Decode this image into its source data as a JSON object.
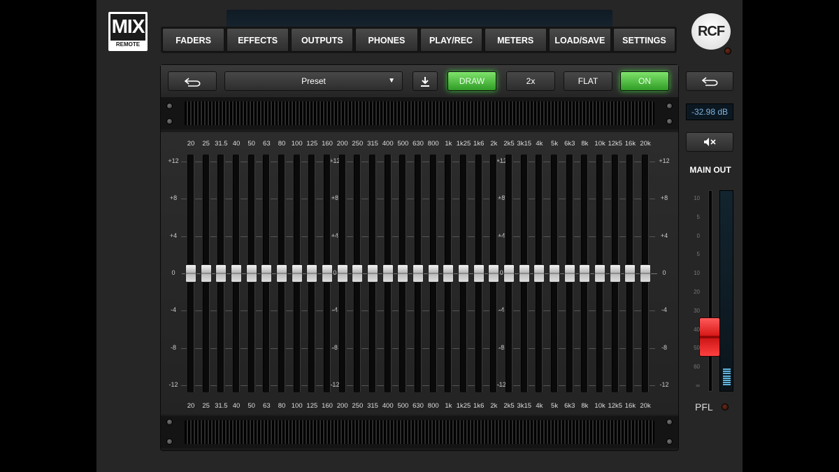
{
  "logo": {
    "main": "MIX",
    "sub": "REMOTE"
  },
  "brand": "RCF",
  "nav": [
    "FADERS",
    "EFFECTS",
    "OUTPUTS",
    "PHONES",
    "PLAY/REC",
    "METERS",
    "LOAD/SAVE",
    "SETTINGS"
  ],
  "toolbar": {
    "back_icon": "undo-arrow-icon",
    "preset_label": "Preset",
    "download_icon": "download-icon",
    "draw_label": "DRAW",
    "x2_label": "2x",
    "flat_label": "FLAT",
    "on_label": "ON",
    "accent_green": "#3fc43a"
  },
  "eq": {
    "bands": [
      "20",
      "25",
      "31.5",
      "40",
      "50",
      "63",
      "80",
      "100",
      "125",
      "160",
      "200",
      "250",
      "315",
      "400",
      "500",
      "630",
      "800",
      "1k",
      "1k25",
      "1k6",
      "2k",
      "2k5",
      "3k15",
      "4k",
      "5k",
      "6k3",
      "8k",
      "10k",
      "12k5",
      "16k",
      "20k"
    ],
    "scale_labels": [
      "+12",
      "+8",
      "+4",
      "0",
      "-4",
      "-8",
      "-12"
    ],
    "scale_values": [
      12,
      8,
      4,
      0,
      -4,
      -8,
      -12
    ],
    "gain_db": [
      0,
      0,
      0,
      0,
      0,
      0,
      0,
      0,
      0,
      0,
      0,
      0,
      0,
      0,
      0,
      0,
      0,
      0,
      0,
      0,
      0,
      0,
      0,
      0,
      0,
      0,
      0,
      0,
      0,
      0,
      0
    ]
  },
  "right": {
    "back_icon": "undo-arrow-icon",
    "readout": "-32.98 dB",
    "mute_icon": "speaker-mute-icon",
    "main_out_label": "MAIN OUT",
    "pfl_label": "PFL",
    "meter_scale": [
      "10",
      "5",
      "0",
      "5",
      "10",
      "20",
      "30",
      "40",
      "50",
      "60",
      "∞"
    ],
    "fader_color": "#d91a1a",
    "readout_color": "#7fb2de"
  }
}
